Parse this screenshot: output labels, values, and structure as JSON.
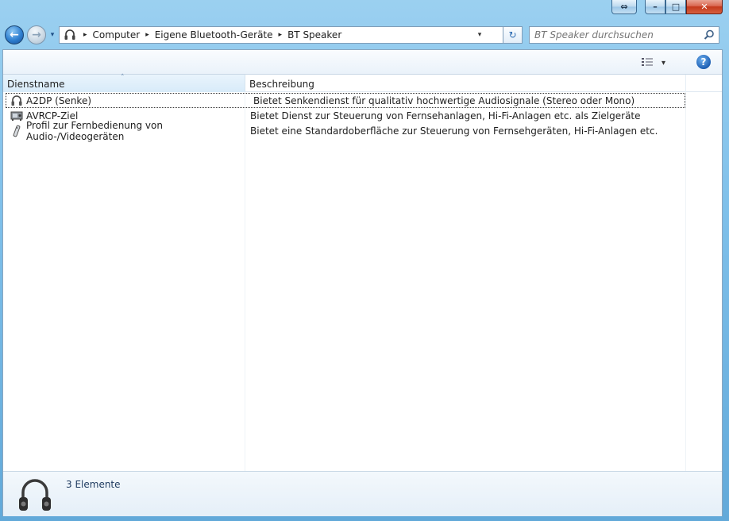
{
  "window": {
    "caption_buttons": {
      "resize": "⇔",
      "minimize": "–",
      "maximize": "□",
      "close": "✕"
    }
  },
  "nav": {
    "back_glyph": "←",
    "forward_glyph": "→",
    "history_dropdown_glyph": "▾",
    "breadcrumb": [
      "Computer",
      "Eigene Bluetooth-Geräte",
      "BT Speaker"
    ],
    "separator_glyph": "▸",
    "address_dropdown_glyph": "▾",
    "refresh_glyph": "↻",
    "search_placeholder": "BT Speaker durchsuchen"
  },
  "toolbar": {
    "view_dropdown_glyph": "▾",
    "help_glyph": "?"
  },
  "list": {
    "columns": [
      "Dienstname",
      "Beschreibung"
    ],
    "sort_glyph": "˄",
    "rows": [
      {
        "name": "A2DP (Senke)",
        "description": "Bietet Senkendienst für qualitativ hochwertige Audiosignale (Stereo oder Mono)",
        "icon": "headphones-icon",
        "selected": true
      },
      {
        "name": "AVRCP-Ziel",
        "description": "Bietet Dienst zur Steuerung von Fernsehanlagen, Hi-Fi-Anlagen etc. als Zielgeräte",
        "icon": "av-device-icon",
        "selected": false
      },
      {
        "name": "Profil zur Fernbedienung von Audio-/Videogeräten",
        "description": "Bietet eine Standardoberfläche zur Steuerung von Fernsehgeräten, Hi-Fi-Anlagen etc.",
        "icon": "remote-control-icon",
        "selected": false
      }
    ]
  },
  "details": {
    "count_text": "3 Elemente",
    "icon": "headphones-icon"
  },
  "colors": {
    "accent": "#2f7fd0",
    "close": "#c4381b",
    "frame": "#7fc0ea"
  }
}
